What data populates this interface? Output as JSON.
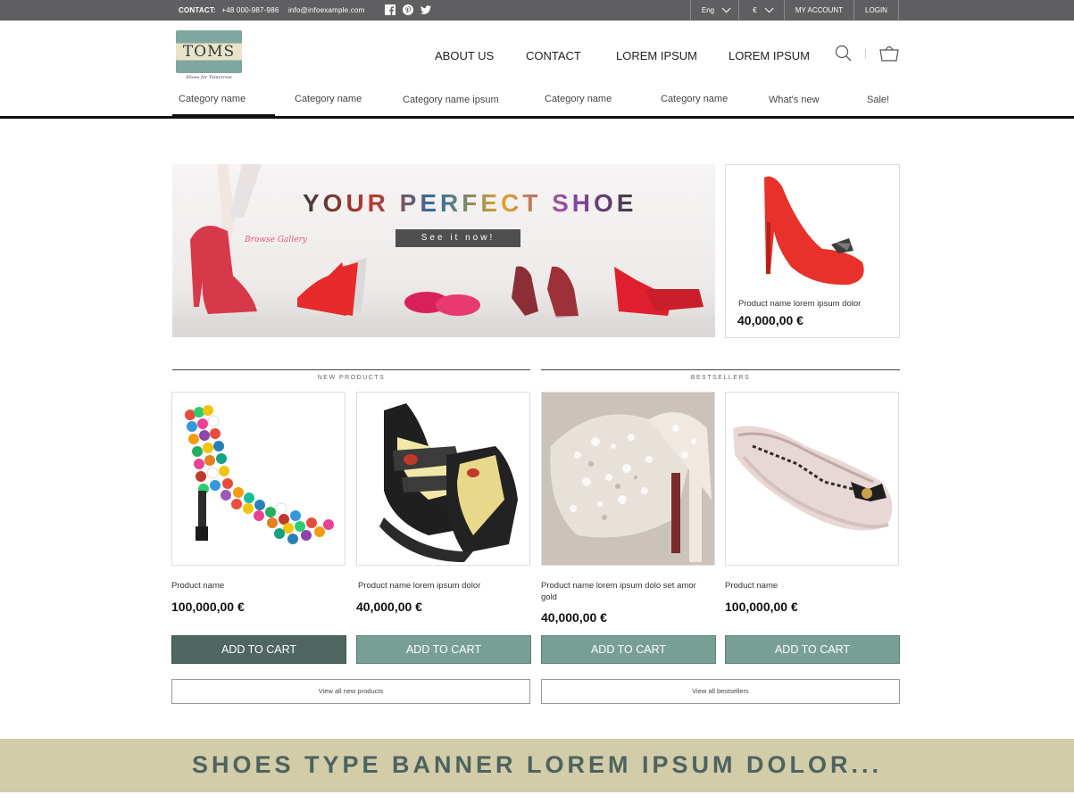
{
  "topbar": {
    "contact_label": "CONTACT:",
    "phone": "+48 000-987-986",
    "email": "info@infoexample.com",
    "social_icons": [
      "facebook-icon",
      "pinterest-icon",
      "twitter-icon"
    ],
    "language": "Eng",
    "currency": "€",
    "my_account": "MY ACCOUNT",
    "login": "LOGIN"
  },
  "logo": {
    "name": "TOMS",
    "tagline": "Shoes for Tomorrow",
    "colors": {
      "teal": "#7fa7a0",
      "cream": "#e9e3c7"
    }
  },
  "main_nav": [
    "ABOUT US",
    "CONTACT",
    "LOREM IPSUM",
    "LOREM IPSUM"
  ],
  "header_icons": [
    "search-icon",
    "cart-icon"
  ],
  "category_nav": [
    "Category name",
    "Category name",
    "Category name ipsum",
    "Category name",
    "Category name",
    "What's new",
    "Sale!"
  ],
  "hero": {
    "title": "YOUR PERFECT SHOE",
    "button": "See it now!",
    "gallery_label": "Browse Gallery"
  },
  "featured": {
    "name": "Product name lorem ipsum dolor",
    "price": "40,000,00 €"
  },
  "sections": {
    "new": "NEW PRODUCTS",
    "best": "BESTSELLERS"
  },
  "products": [
    {
      "name": "Product name",
      "price": "100,000,00 €",
      "button": "ADD TO CART"
    },
    {
      "name": "Product name lorem ipsum dolor",
      "price": "40,000,00 €",
      "button": "ADD TO CART"
    },
    {
      "name": "Product name lorem ipsum dolo set amor gold",
      "price": "40,000,00 €",
      "button": "ADD TO CART"
    },
    {
      "name": "Product name",
      "price": "100,000,00 €",
      "button": "ADD TO CART"
    }
  ],
  "view_all": {
    "new": "View all new products",
    "best": "View all bestsellers"
  },
  "banner": {
    "text": "SHOES TYPE BANNER LOREM IPSUM DOLOR...",
    "background": "#d2cda8",
    "text_color": "#4d6360"
  },
  "colors": {
    "topbar": "#5f5f61",
    "cart_button": "#789f96",
    "cart_button_active": "#4f6661"
  }
}
